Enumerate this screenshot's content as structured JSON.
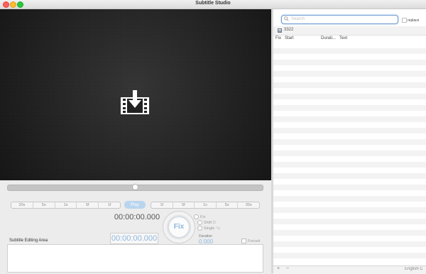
{
  "window": {
    "title": "Subtitle Studio"
  },
  "video": {
    "icon": "import-video-icon"
  },
  "transport": {
    "left_steps": [
      "20s",
      "5s",
      "1s",
      "5f",
      "1f"
    ],
    "play_label": "Play",
    "right_steps": [
      "1f",
      "5f",
      "1s",
      "5s",
      "30s"
    ],
    "timecode": "00:00:00.000"
  },
  "fix_panel": {
    "fix_label": "Fix",
    "options": [
      "Fix",
      "Shift ⎋",
      "Single ⌥"
    ],
    "duration_label": "Duration",
    "duration_value": "0.000",
    "subtitle_time": "00:00:00.000",
    "forced_label": "Forced"
  },
  "editor": {
    "label": "Subtitle Editing Area"
  },
  "subtitles": {
    "search_placeholder": "Search",
    "replace_label": "replace",
    "count": "3322",
    "columns": [
      "Fix",
      "Start",
      "Durati...",
      "Text"
    ],
    "language": "English C"
  },
  "colors": {
    "accent": "#8fb6de",
    "play": "#b9d5ee",
    "video_bg": "#222222"
  }
}
